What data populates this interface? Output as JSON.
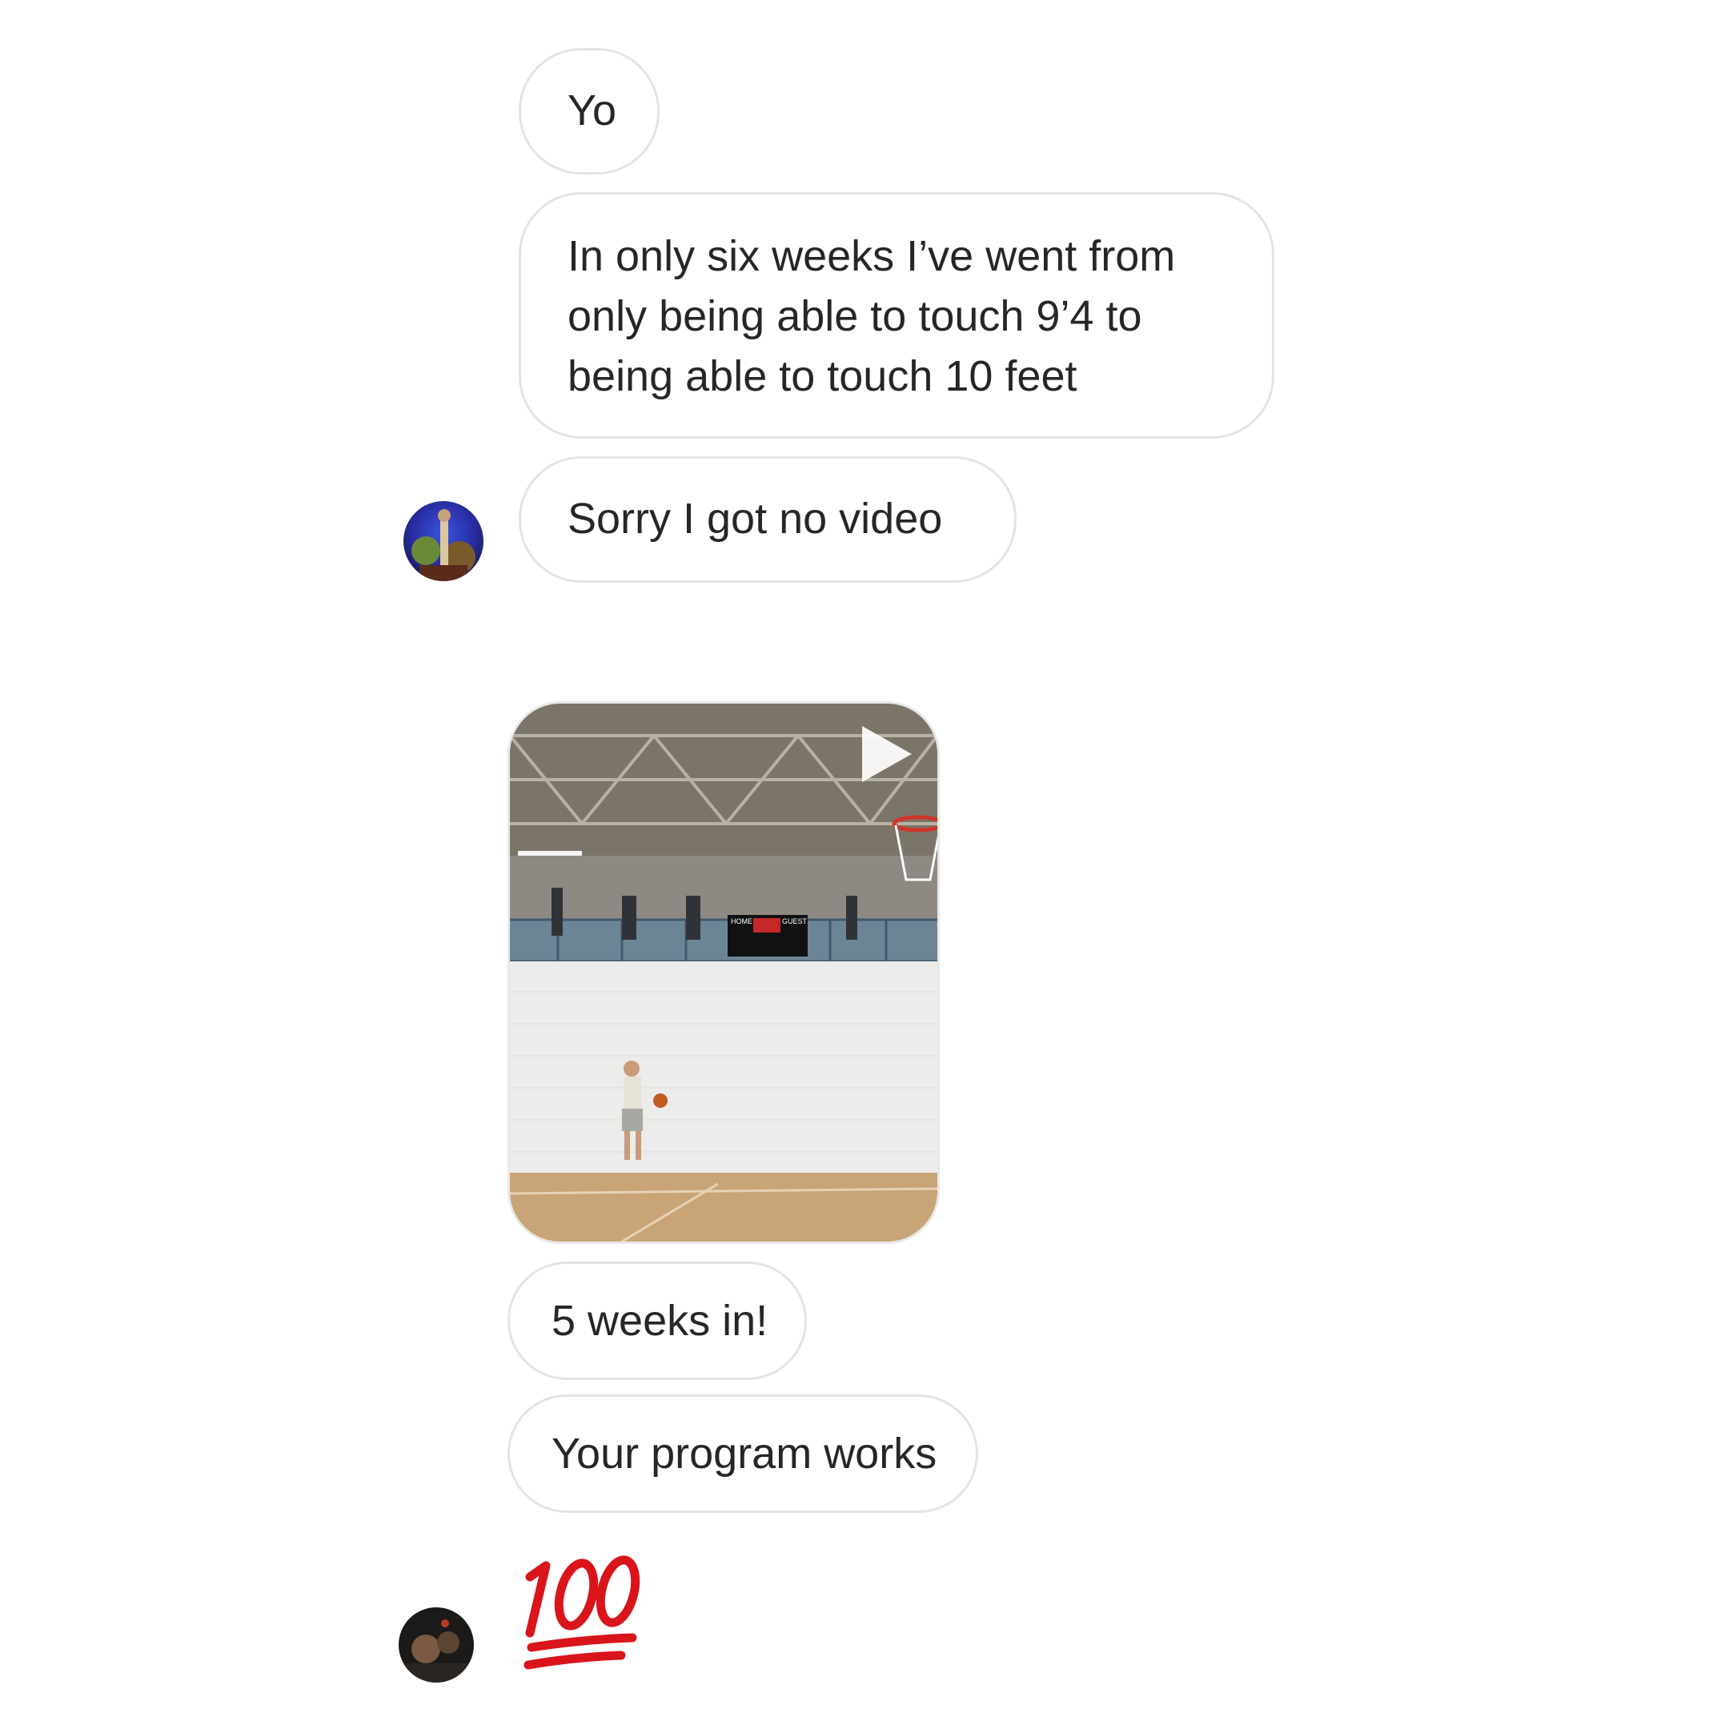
{
  "conversation": {
    "messages": [
      {
        "type": "text",
        "lines": [
          "Yo"
        ]
      },
      {
        "type": "text",
        "lines": [
          "In only six weeks I’ve went from",
          "only being able to touch 9’4 to",
          "being able to touch 10 feet"
        ]
      },
      {
        "type": "text",
        "lines": [
          "Sorry I got no video"
        ]
      },
      {
        "type": "video",
        "scoreboard": {
          "home_label": "HOME",
          "guest_label": "GUEST"
        }
      },
      {
        "type": "text",
        "lines": [
          "5 weeks in!"
        ]
      },
      {
        "type": "text",
        "lines": [
          "Your program works"
        ]
      },
      {
        "type": "emoji",
        "emoji": "100"
      }
    ]
  },
  "icons": {
    "play": "play-icon",
    "hundred": "hundred-points-emoji"
  },
  "colors": {
    "bubble_border": "#e4e4e4",
    "text": "#262626",
    "emoji_red": "#d9141b"
  }
}
